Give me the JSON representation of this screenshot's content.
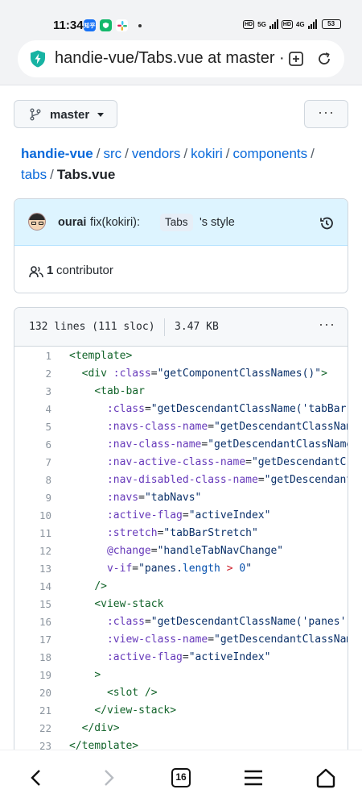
{
  "status_bar": {
    "time": "11:34",
    "apps": [
      {
        "icon": "zhihu-app-icon",
        "label": "知乎",
        "color": "#1772f6"
      },
      {
        "icon": "shield-app-icon",
        "label": "",
        "color": "#14b86b"
      },
      {
        "icon": "slack-app-icon",
        "label": "",
        "color": "#e8a33d"
      }
    ],
    "network_1": "5G",
    "network_2": "4G",
    "hd_label": "HD",
    "battery": "53"
  },
  "browser": {
    "url": "handie-vue/Tabs.vue at master · ourai/handie-vue",
    "tabs_count": "16"
  },
  "branch": {
    "name": "master"
  },
  "more_label": "···",
  "breadcrumb": {
    "repo": "handie-vue",
    "parts": [
      "src",
      "vendors",
      "kokiri",
      "components",
      "tabs"
    ],
    "file": "Tabs.vue",
    "separator": "/"
  },
  "commit": {
    "author": "ourai",
    "message_prefix": "fix(kokiri):",
    "message_code": "Tabs",
    "message_suffix": "'s style",
    "contributors_count": "1",
    "contributors_label": "contributor"
  },
  "file_info": {
    "lines": "132 lines (111 sloc)",
    "size": "3.47 KB"
  },
  "code_lines": [
    {
      "n": "1",
      "segments": [
        [
          "tag",
          "<template>"
        ]
      ]
    },
    {
      "n": "2",
      "segments": [
        [
          "plain",
          "  "
        ],
        [
          "tag",
          "<div "
        ],
        [
          "attr",
          ":class"
        ],
        [
          "plain",
          "="
        ],
        [
          "str",
          "\"getComponentClassNames()\""
        ],
        [
          "tag",
          ">"
        ]
      ]
    },
    {
      "n": "3",
      "segments": [
        [
          "plain",
          "    "
        ],
        [
          "tag",
          "<tab-bar"
        ]
      ]
    },
    {
      "n": "4",
      "segments": [
        [
          "plain",
          "      "
        ],
        [
          "attr",
          ":class"
        ],
        [
          "plain",
          "="
        ],
        [
          "str",
          "\"getDescendantClassName('tabBar"
        ]
      ]
    },
    {
      "n": "5",
      "segments": [
        [
          "plain",
          "      "
        ],
        [
          "attr",
          ":navs-class-name"
        ],
        [
          "plain",
          "="
        ],
        [
          "str",
          "\"getDescendantClassNam"
        ]
      ]
    },
    {
      "n": "6",
      "segments": [
        [
          "plain",
          "      "
        ],
        [
          "attr",
          ":nav-class-name"
        ],
        [
          "plain",
          "="
        ],
        [
          "str",
          "\"getDescendantClassName"
        ]
      ]
    },
    {
      "n": "7",
      "segments": [
        [
          "plain",
          "      "
        ],
        [
          "attr",
          ":nav-active-class-name"
        ],
        [
          "plain",
          "="
        ],
        [
          "str",
          "\"getDescendantC"
        ]
      ]
    },
    {
      "n": "8",
      "segments": [
        [
          "plain",
          "      "
        ],
        [
          "attr",
          ":nav-disabled-class-name"
        ],
        [
          "plain",
          "="
        ],
        [
          "str",
          "\"getDescendant"
        ]
      ]
    },
    {
      "n": "9",
      "segments": [
        [
          "plain",
          "      "
        ],
        [
          "attr",
          ":navs"
        ],
        [
          "plain",
          "="
        ],
        [
          "str",
          "\"tabNavs\""
        ]
      ]
    },
    {
      "n": "10",
      "segments": [
        [
          "plain",
          "      "
        ],
        [
          "attr",
          ":active-flag"
        ],
        [
          "plain",
          "="
        ],
        [
          "str",
          "\"activeIndex\""
        ]
      ]
    },
    {
      "n": "11",
      "segments": [
        [
          "plain",
          "      "
        ],
        [
          "attr",
          ":stretch"
        ],
        [
          "plain",
          "="
        ],
        [
          "str",
          "\"tabBarStretch\""
        ]
      ]
    },
    {
      "n": "12",
      "segments": [
        [
          "plain",
          "      "
        ],
        [
          "attr",
          "@change"
        ],
        [
          "plain",
          "="
        ],
        [
          "str",
          "\"handleTabNavChange\""
        ]
      ]
    },
    {
      "n": "13",
      "segments": [
        [
          "plain",
          "      "
        ],
        [
          "attr",
          "v-if"
        ],
        [
          "plain",
          "="
        ],
        [
          "str",
          "\"panes."
        ],
        [
          "kw",
          "length"
        ],
        [
          "str",
          " "
        ],
        [
          "op",
          ">"
        ],
        [
          "str",
          " "
        ],
        [
          "kw",
          "0"
        ],
        [
          "str",
          "\""
        ]
      ]
    },
    {
      "n": "14",
      "segments": [
        [
          "plain",
          "    "
        ],
        [
          "tag",
          "/>"
        ]
      ]
    },
    {
      "n": "15",
      "segments": [
        [
          "plain",
          "    "
        ],
        [
          "tag",
          "<view-stack"
        ]
      ]
    },
    {
      "n": "16",
      "segments": [
        [
          "plain",
          "      "
        ],
        [
          "attr",
          ":class"
        ],
        [
          "plain",
          "="
        ],
        [
          "str",
          "\"getDescendantClassName('panes'"
        ]
      ]
    },
    {
      "n": "17",
      "segments": [
        [
          "plain",
          "      "
        ],
        [
          "attr",
          ":view-class-name"
        ],
        [
          "plain",
          "="
        ],
        [
          "str",
          "\"getDescendantClassNam"
        ]
      ]
    },
    {
      "n": "18",
      "segments": [
        [
          "plain",
          "      "
        ],
        [
          "attr",
          ":active-flag"
        ],
        [
          "plain",
          "="
        ],
        [
          "str",
          "\"activeIndex\""
        ]
      ]
    },
    {
      "n": "19",
      "segments": [
        [
          "plain",
          "    "
        ],
        [
          "tag",
          ">"
        ]
      ]
    },
    {
      "n": "20",
      "segments": [
        [
          "plain",
          "      "
        ],
        [
          "tag",
          "<slot />"
        ]
      ]
    },
    {
      "n": "21",
      "segments": [
        [
          "plain",
          "    "
        ],
        [
          "tag",
          "</view-stack>"
        ]
      ]
    },
    {
      "n": "22",
      "segments": [
        [
          "plain",
          "  "
        ],
        [
          "tag",
          "</div>"
        ]
      ]
    },
    {
      "n": "23",
      "segments": [
        [
          "tag",
          "</template>"
        ]
      ]
    }
  ]
}
